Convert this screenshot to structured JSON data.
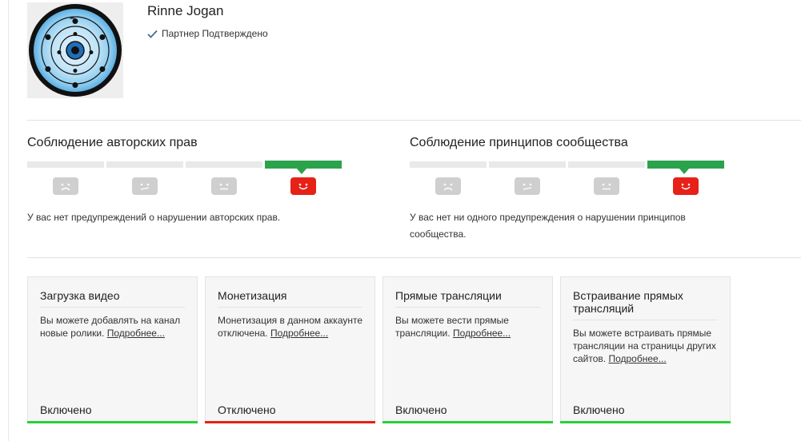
{
  "channel": {
    "name": "Rinne Jogan",
    "partner_status": "Партнер Подтверждено"
  },
  "copyright": {
    "title": "Соблюдение авторских прав",
    "message": "У вас нет предупреждений о нарушении авторских прав.",
    "level": 4
  },
  "community": {
    "title": "Соблюдение принципов сообщества",
    "message": "У вас нет ни одного предупреждения о нарушении принципов сообщества.",
    "level": 4
  },
  "colors": {
    "good": "#2ba24c",
    "bad": "#e62117",
    "enabled_bar": "#2bd03a",
    "disabled_bar": "#e62117"
  },
  "features": [
    {
      "title": "Загрузка видео",
      "description": "Вы можете добавлять на канал новые ролики.",
      "more": "Подробнее...",
      "status": "Включено",
      "enabled": true
    },
    {
      "title": "Монетизация",
      "description": "Монетизация в данном аккаунте отключена.",
      "more": "Подробнее...",
      "status": "Отключено",
      "enabled": false
    },
    {
      "title": "Прямые трансляции",
      "description": "Вы можете вести прямые трансляции.",
      "more": "Подробнее...",
      "status": "Включено",
      "enabled": true
    },
    {
      "title": "Встраивание прямых трансляций",
      "description": "Вы можете встраивать прямые трансляции на страницы других сайтов.",
      "more": "Подробнее...",
      "status": "Включено",
      "enabled": true
    }
  ]
}
